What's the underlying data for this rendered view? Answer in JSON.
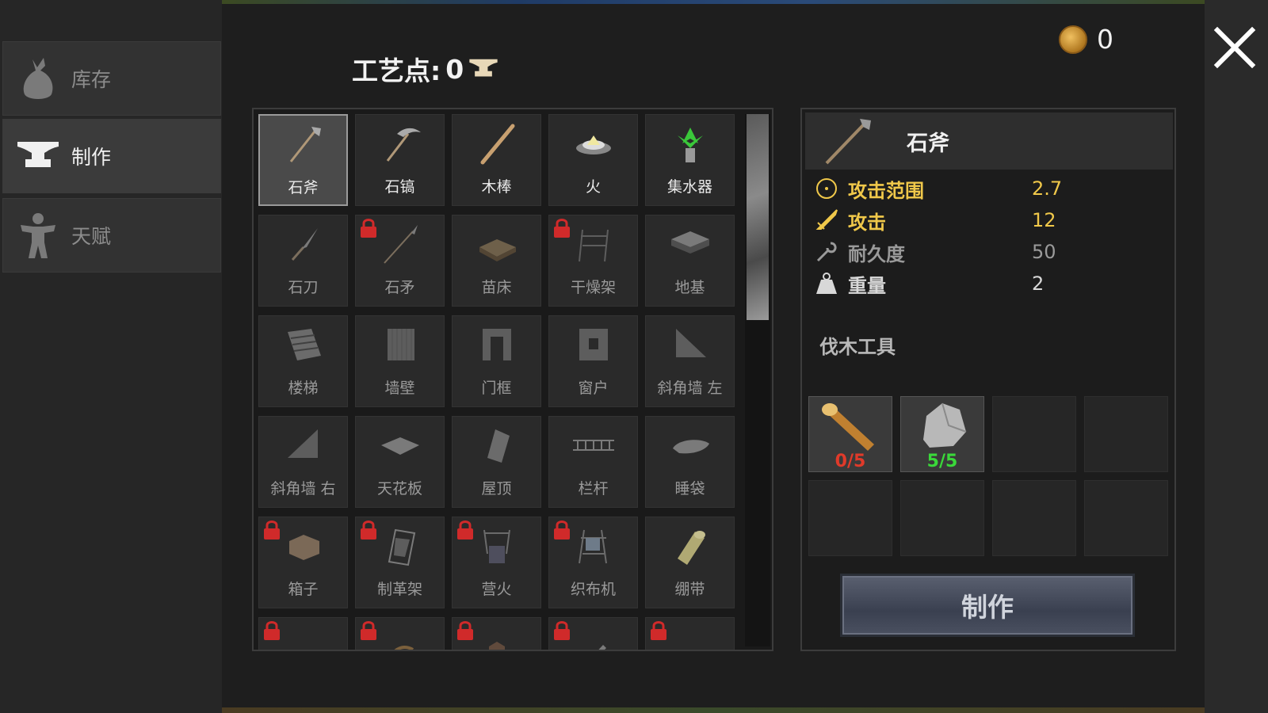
{
  "sidebar": {
    "tabs": [
      {
        "label": "库存",
        "icon": "bag-icon",
        "active": false
      },
      {
        "label": "制作",
        "icon": "anvil-icon",
        "active": true
      },
      {
        "label": "天赋",
        "icon": "talent-figure-icon",
        "active": false
      }
    ]
  },
  "header": {
    "craft_points_label": "工艺点:",
    "craft_points_value": "0",
    "coins": "0"
  },
  "recipes": [
    {
      "name": "石斧",
      "icon": "stone-axe-icon",
      "locked": false,
      "selected": true
    },
    {
      "name": "石镐",
      "icon": "stone-pickaxe-icon",
      "locked": false
    },
    {
      "name": "木棒",
      "icon": "wooden-stick-icon",
      "locked": false
    },
    {
      "name": "火",
      "icon": "fire-icon",
      "locked": false
    },
    {
      "name": "集水器",
      "icon": "water-collector-icon",
      "locked": false
    },
    {
      "name": "石刀",
      "icon": "stone-knife-icon",
      "locked": false,
      "dim": true
    },
    {
      "name": "石矛",
      "icon": "stone-spear-icon",
      "locked": true
    },
    {
      "name": "苗床",
      "icon": "seedbed-icon",
      "locked": false,
      "dim": true
    },
    {
      "name": "干燥架",
      "icon": "drying-rack-icon",
      "locked": true
    },
    {
      "name": "地基",
      "icon": "foundation-icon",
      "locked": false,
      "dim": true
    },
    {
      "name": "楼梯",
      "icon": "stairs-icon",
      "locked": false,
      "dim": true
    },
    {
      "name": "墙壁",
      "icon": "wall-icon",
      "locked": false,
      "dim": true
    },
    {
      "name": "门框",
      "icon": "door-frame-icon",
      "locked": false,
      "dim": true
    },
    {
      "name": "窗户",
      "icon": "window-icon",
      "locked": false,
      "dim": true
    },
    {
      "name": "斜角墙 左",
      "icon": "slope-wall-left-icon",
      "locked": false,
      "dim": true
    },
    {
      "name": "斜角墙 右",
      "icon": "slope-wall-right-icon",
      "locked": false,
      "dim": true
    },
    {
      "name": "天花板",
      "icon": "ceiling-icon",
      "locked": false,
      "dim": true
    },
    {
      "name": "屋顶",
      "icon": "roof-icon",
      "locked": false,
      "dim": true
    },
    {
      "name": "栏杆",
      "icon": "railing-icon",
      "locked": false,
      "dim": true
    },
    {
      "name": "睡袋",
      "icon": "sleeping-bag-icon",
      "locked": false,
      "dim": true
    },
    {
      "name": "箱子",
      "icon": "chest-icon",
      "locked": true
    },
    {
      "name": "制革架",
      "icon": "tanning-rack-icon",
      "locked": true
    },
    {
      "name": "营火",
      "icon": "campfire-icon",
      "locked": true
    },
    {
      "name": "织布机",
      "icon": "loom-icon",
      "locked": true
    },
    {
      "name": "绷带",
      "icon": "bandage-icon",
      "locked": false,
      "dim": true
    },
    {
      "name": "",
      "icon": "rope-icon",
      "locked": true,
      "partial": true
    },
    {
      "name": "",
      "icon": "bow-icon",
      "locked": true,
      "partial": true
    },
    {
      "name": "",
      "icon": "leather-armor-icon",
      "locked": true,
      "partial": true
    },
    {
      "name": "",
      "icon": "knife-icon",
      "locked": true,
      "partial": true
    },
    {
      "name": "",
      "icon": "helmet-icon",
      "locked": true,
      "partial": true
    }
  ],
  "detail": {
    "title": "石斧",
    "icon": "stone-axe-icon",
    "stats": [
      {
        "label": "攻击范围",
        "value": "2.7",
        "icon": "range-circle-icon",
        "color": "#f0c84a"
      },
      {
        "label": "攻击",
        "value": "12",
        "icon": "sword-icon",
        "color": "#f0c84a"
      },
      {
        "label": "耐久度",
        "value": "50",
        "icon": "wrench-icon",
        "color": "#9a9a9a"
      },
      {
        "label": "重量",
        "value": "2",
        "icon": "weight-icon",
        "color": "#d8d8d8"
      }
    ],
    "description": "伐木工具",
    "materials": [
      {
        "icon": "wood-log-icon",
        "count": "0/5",
        "color": "#e03a2a"
      },
      {
        "icon": "stone-icon",
        "count": "5/5",
        "color": "#3ad83a"
      }
    ],
    "craft_button": "制作"
  }
}
